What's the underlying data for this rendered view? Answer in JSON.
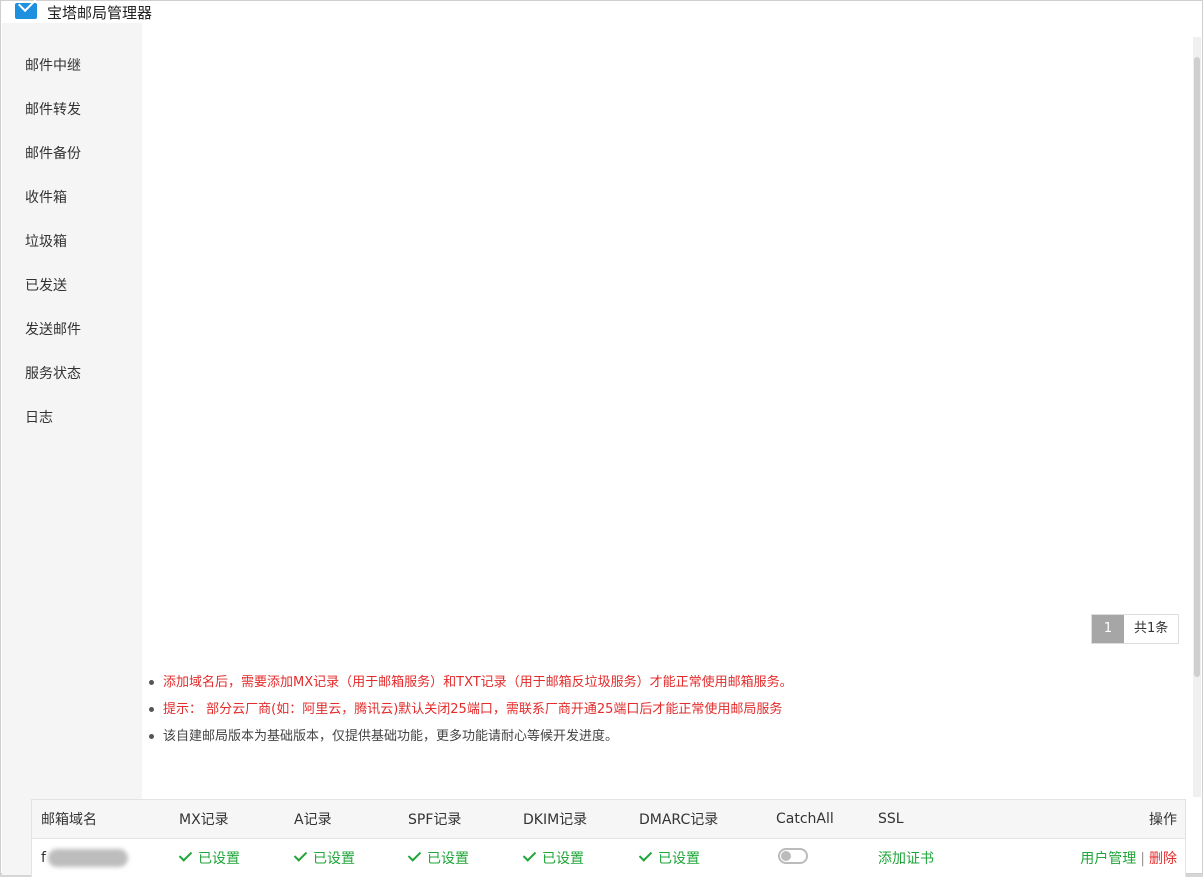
{
  "window": {
    "title": "宝塔邮局管理器",
    "icon": "mail-icon"
  },
  "sidebar": {
    "items": [
      {
        "label": "邮件中继"
      },
      {
        "label": "邮件转发"
      },
      {
        "label": "邮件备份"
      },
      {
        "label": "收件箱"
      },
      {
        "label": "垃圾箱"
      },
      {
        "label": "已发送"
      },
      {
        "label": "发送邮件"
      },
      {
        "label": "服务状态"
      },
      {
        "label": "日志"
      }
    ]
  },
  "pagination": {
    "current_page": "1",
    "total": "共1条"
  },
  "tips": [
    "添加域名后，需要添加MX记录（用于邮箱服务）和TXT记录（用于邮箱反垃圾服务）才能正常使用邮箱服务。",
    "提示： 部分云厂商(如：阿里云，腾讯云)默认关闭25端口，需联系厂商开通25端口后才能正常使用邮局服务",
    "该自建邮局版本为基础版本，仅提供基础功能，更多功能请耐心等候开发进度。"
  ],
  "table": {
    "headers": {
      "domain": "邮箱域名",
      "mx": "MX记录",
      "a": "A记录",
      "spf": "SPF记录",
      "dkim": "DKIM记录",
      "dmarc": "DMARC记录",
      "catchall": "CatchAll",
      "ssl": "SSL",
      "action": "操作"
    },
    "rows": [
      {
        "domain": "f",
        "mx": "已设置",
        "a": "已设置",
        "spf": "已设置",
        "dkim": "已设置",
        "dmarc": "已设置",
        "catchall_enabled": false,
        "ssl": "添加证书",
        "user_manage": "用户管理",
        "separator": "|",
        "delete": "删除"
      }
    ]
  },
  "colors": {
    "accent_green": "#20a53a",
    "warning_red": "#e32b2b",
    "title_icon_blue": "#1f8fe0"
  }
}
